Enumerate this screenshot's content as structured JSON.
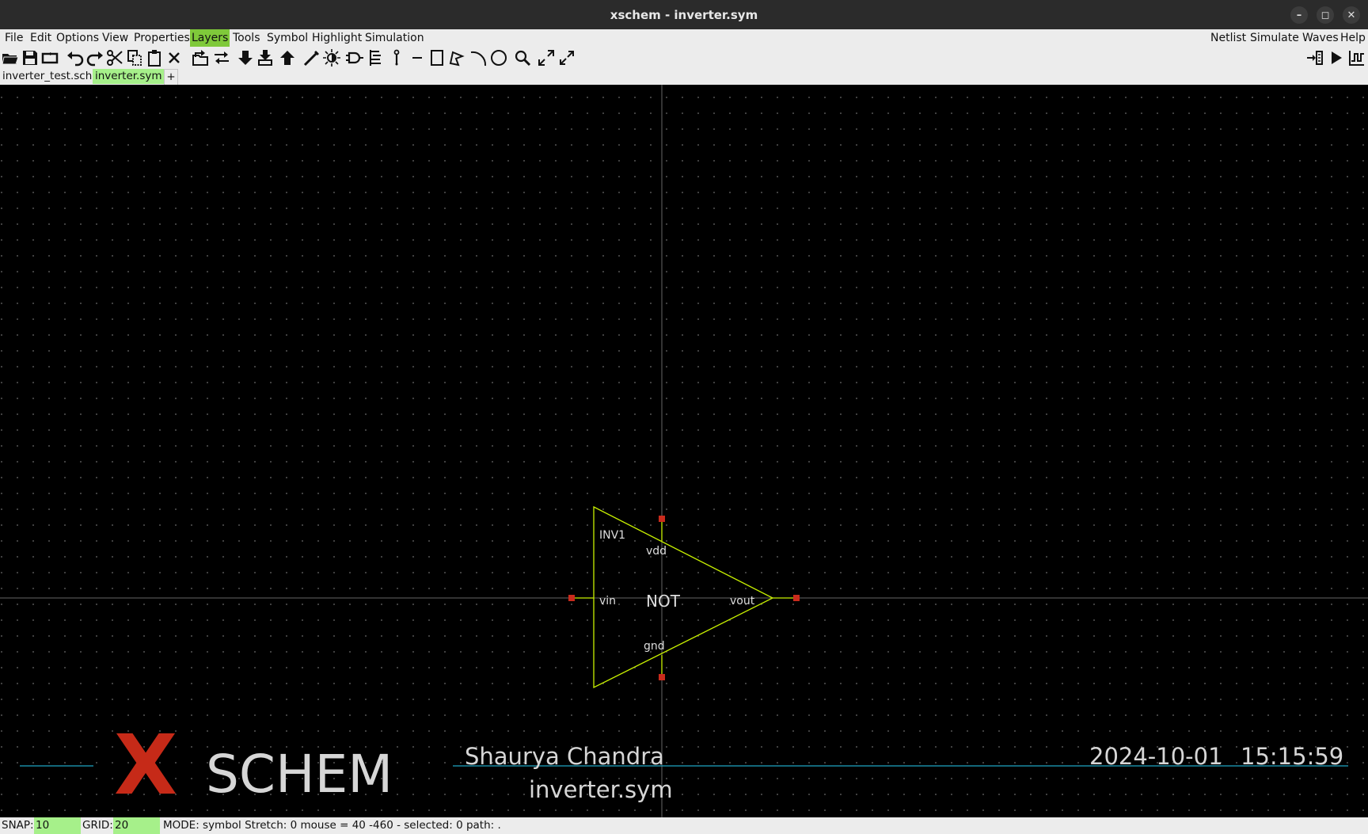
{
  "window": {
    "title": "xschem - inverter.sym",
    "controls": {
      "minimize": "–",
      "maximize": "◻",
      "close": "✕"
    }
  },
  "menubar": {
    "left": [
      "File",
      "Edit",
      "Options",
      "View",
      "Properties",
      "Layers",
      "Tools",
      "Symbol",
      "Highlight",
      "Simulation"
    ],
    "right": [
      "Netlist",
      "Simulate",
      "Waves",
      "Help"
    ],
    "active": "Layers",
    "active_color": "#7fc93a"
  },
  "toolbar": {
    "icons": [
      "open-file-icon",
      "save-icon",
      "reload-icon",
      "undo-icon",
      "redo-icon",
      "cut-icon",
      "copy-icon",
      "paste-icon",
      "delete-icon",
      "open-parent-icon",
      "swap-icon",
      "descend-icon",
      "descend-symbol-icon",
      "go-back-icon",
      "wire-icon",
      "highlight-icon",
      "insert-symbol-icon",
      "align-icon",
      "pin-icon",
      "line-icon",
      "rect-icon",
      "polygon-icon",
      "arc-icon",
      "circle-icon",
      "zoom-icon",
      "zoom-in-icon",
      "zoom-out-icon",
      "netlist-icon",
      "simulate-icon",
      "waves-icon"
    ]
  },
  "tabs": {
    "items": [
      "inverter_test.sch",
      "inverter.sym"
    ],
    "active": "inverter.sym",
    "add_label": "+",
    "active_color": "#a6f08a"
  },
  "canvas": {
    "background": "#000000",
    "symbol": {
      "instance_name": "INV1",
      "center_label": "NOT",
      "pins": {
        "vdd": "vdd",
        "vin": "vin",
        "vout": "vout",
        "gnd": "gnd"
      },
      "stroke_color": "#c8f000",
      "pin_color": "#c92b1c"
    },
    "title_block": {
      "logo_x": "X",
      "logo_text": "SCHEM",
      "author": "Shaurya Chandra",
      "filename": "inverter.sym",
      "date": "2024-10-01",
      "time": "15:15:59",
      "logo_color": "#c62a18",
      "line_color": "#1fa5c4"
    }
  },
  "statusbar": {
    "snap_label": "SNAP:",
    "snap_value": "10",
    "grid_label": "GRID:",
    "grid_value": "20",
    "mode_text": "MODE:  symbol  Stretch: 0  mouse = 40 -460 - selected: 0 path: ."
  }
}
